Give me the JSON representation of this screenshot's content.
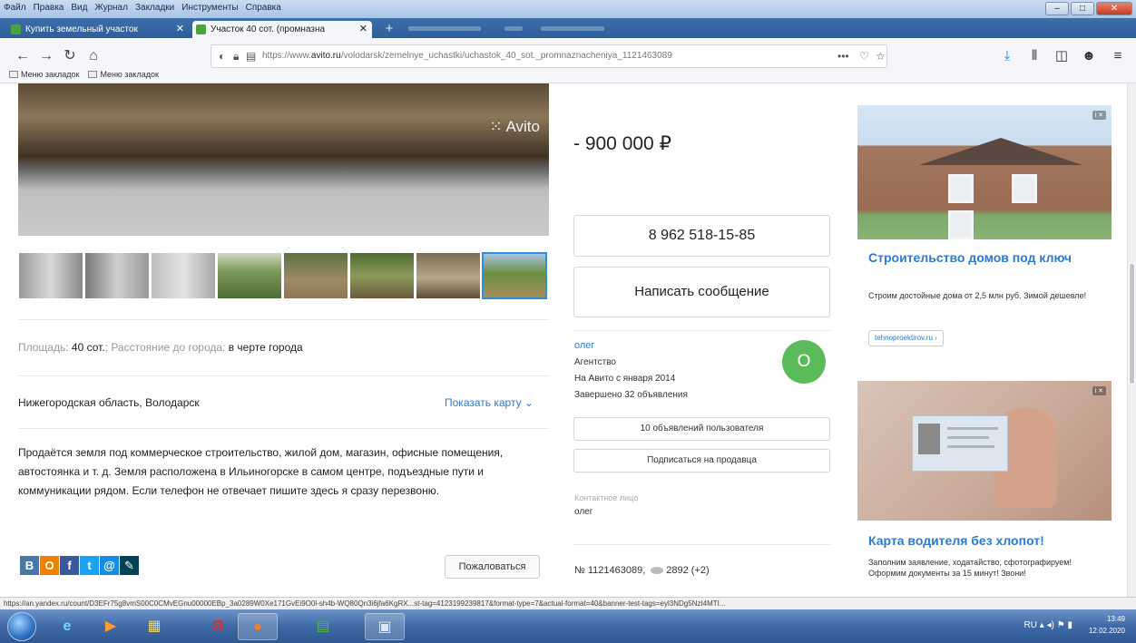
{
  "browser": {
    "menu": [
      "Файл",
      "Правка",
      "Вид",
      "Журнал",
      "Закладки",
      "Инструменты",
      "Справка"
    ],
    "tabs": [
      {
        "label": "Купить земельный участок"
      },
      {
        "label": "Участок 40 сот. (промназна"
      }
    ],
    "url_prefix": "https://www.",
    "url_domain": "avito.ru",
    "url_path": "/volodarsk/zemelnye_uchastki/uchastok_40_sot._promnaznacheniya_1121463089",
    "bookmarks": [
      "Меню закладок",
      "Меню закладок"
    ],
    "status_url": "https://an.yandex.ru/count/D3EFr75g8vmS00C0CMvEGnu00000EBp_3a0289W0Xe171GvEi9O0l-sh4b-WQ80Qn3i6jfa6KgRX...st-tag=4123199239817&format-type=7&actual-format=40&banner-test-tags=eyl3NDg5NzI4MTI..."
  },
  "listing": {
    "watermark": "Avito",
    "params_area_label": "Площадь:",
    "params_area_value": "40 сот.",
    "params_distance_label": "Расстояние до города:",
    "params_distance_value": "в черте города",
    "address": "Нижегородская область, Володарск",
    "show_map": "Показать карту",
    "description": "Продаётся земля под коммерческое строительство, жилой дом, магазин, офисные помещения, автостоянка и т. д. Земля расположена в Ильиногорске в самом центре, подъездные пути и коммуникации рядом. Если телефон не отвечает пишите здесь я сразу перезвоню.",
    "complain": "Пожаловаться",
    "social": [
      {
        "icon": "vk-icon",
        "glyph": "В",
        "color": "#4a76a8"
      },
      {
        "icon": "odnoklassniki-icon",
        "glyph": "О",
        "color": "#ee8208"
      },
      {
        "icon": "facebook-icon",
        "glyph": "f",
        "color": "#3b5998"
      },
      {
        "icon": "twitter-icon",
        "glyph": "t",
        "color": "#1da1f2"
      },
      {
        "icon": "mailru-icon",
        "glyph": "@",
        "color": "#168de2"
      },
      {
        "icon": "livejournal-icon",
        "glyph": "✎",
        "color": "#004359"
      }
    ]
  },
  "seller": {
    "price": "900 000 ₽",
    "phone": "8 962 518-15-85",
    "message_button": "Написать сообщение",
    "name": "олег",
    "type": "Агентство",
    "since": "На Авито с января 2014",
    "completed": "Завершено 32 объявления",
    "avatar_letter": "О",
    "ads_button": "10 объявлений пользователя",
    "subscribe_button": "Подписаться на продавца",
    "contact_label": "Контактное лицо",
    "contact_name": "олег",
    "ad_number": "№ 1121463089,",
    "views": "2892 (+2)"
  },
  "ads": {
    "ad1_title": "Строительство домов под ключ",
    "ad1_text": "Строим достойные дома от 2,5 млн руб. Зимой дешевле!",
    "ad1_link": "tehnoproektirov.ru ›",
    "ad2_title": "Карта водителя без хлопот!",
    "ad2_text": "Заполним заявление, ходатайство, сфотографируем! Оформим документы за 15 минут! Звони!"
  },
  "taskbar": {
    "lang": "RU",
    "time": "13:49",
    "date": "12.02.2020"
  }
}
